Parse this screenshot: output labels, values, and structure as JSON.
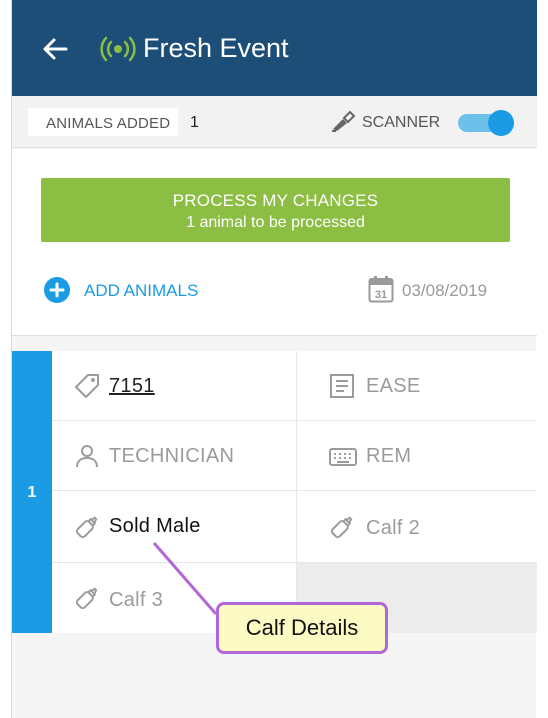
{
  "topbar": {
    "title": "Fresh Event",
    "back_icon": "arrow-left-icon",
    "live_icon": "broadcast-icon"
  },
  "status": {
    "animals_added_label": "ANIMALS ADDED",
    "animals_added_count": "1",
    "scanner_label": "SCANNER",
    "scanner_on": true
  },
  "process": {
    "title": "PROCESS MY CHANGES",
    "subtitle": "1 animal to be processed"
  },
  "actions": {
    "add_animals": "ADD ANIMALS",
    "date": "03/08/2019",
    "date_icon_day": "31"
  },
  "animal": {
    "index": "1",
    "tag": "7151",
    "ease": "EASE",
    "technician": "TECHNICIAN",
    "rem": "REM",
    "calf1": "Sold Male",
    "calf2": "Calf 2",
    "calf3": "Calf 3"
  },
  "callout": {
    "label": "Calf Details"
  },
  "colors": {
    "header": "#1c4e77",
    "accent": "#1a9be3",
    "process": "#8cbe44",
    "callout_border": "#b366d6",
    "callout_fill": "#fdfbc4",
    "live": "#8cbe44"
  }
}
